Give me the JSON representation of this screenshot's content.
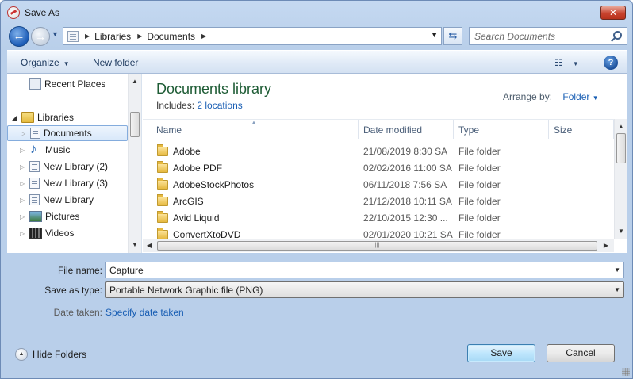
{
  "window": {
    "title": "Save As",
    "close_label": "✕"
  },
  "address_bar": {
    "breadcrumbs": [
      "Libraries",
      "Documents"
    ],
    "search_placeholder": "Search Documents"
  },
  "toolbar": {
    "organize_label": "Organize",
    "new_folder_label": "New folder",
    "help_label": "?"
  },
  "navigation": {
    "items": [
      {
        "label": "Recent Places"
      },
      {
        "label": "Libraries"
      },
      {
        "label": "Documents"
      },
      {
        "label": "Music"
      },
      {
        "label": "New Library (2)"
      },
      {
        "label": "New Library (3)"
      },
      {
        "label": "New Library"
      },
      {
        "label": "Pictures"
      },
      {
        "label": "Videos"
      }
    ],
    "selected": "Documents"
  },
  "library": {
    "title": "Documents library",
    "includes_label": "Includes:",
    "includes_link": "2 locations",
    "arrange_label": "Arrange by:",
    "arrange_value": "Folder"
  },
  "columns": {
    "name": "Name",
    "date": "Date modified",
    "type": "Type",
    "size": "Size"
  },
  "files": [
    {
      "name": "Adobe",
      "date": "21/08/2019 8:30 SA",
      "type": "File folder"
    },
    {
      "name": "Adobe PDF",
      "date": "02/02/2016 11:00 SA",
      "type": "File folder"
    },
    {
      "name": "AdobeStockPhotos",
      "date": "06/11/2018 7:56 SA",
      "type": "File folder"
    },
    {
      "name": "ArcGIS",
      "date": "21/12/2018 10:11 SA",
      "type": "File folder"
    },
    {
      "name": "Avid Liquid",
      "date": "22/10/2015 12:30 ...",
      "type": "File folder"
    },
    {
      "name": "ConvertXtoDVD",
      "date": "02/01/2020 10:21 SA",
      "type": "File folder"
    }
  ],
  "form": {
    "file_name_label": "File name:",
    "file_name_value": "Capture",
    "save_type_label": "Save as type:",
    "save_type_value": "Portable Network Graphic file (PNG)",
    "date_taken_label": "Date taken:",
    "date_taken_link": "Specify date taken"
  },
  "footer": {
    "hide_folders_label": "Hide Folders",
    "save_label": "Save",
    "cancel_label": "Cancel"
  }
}
